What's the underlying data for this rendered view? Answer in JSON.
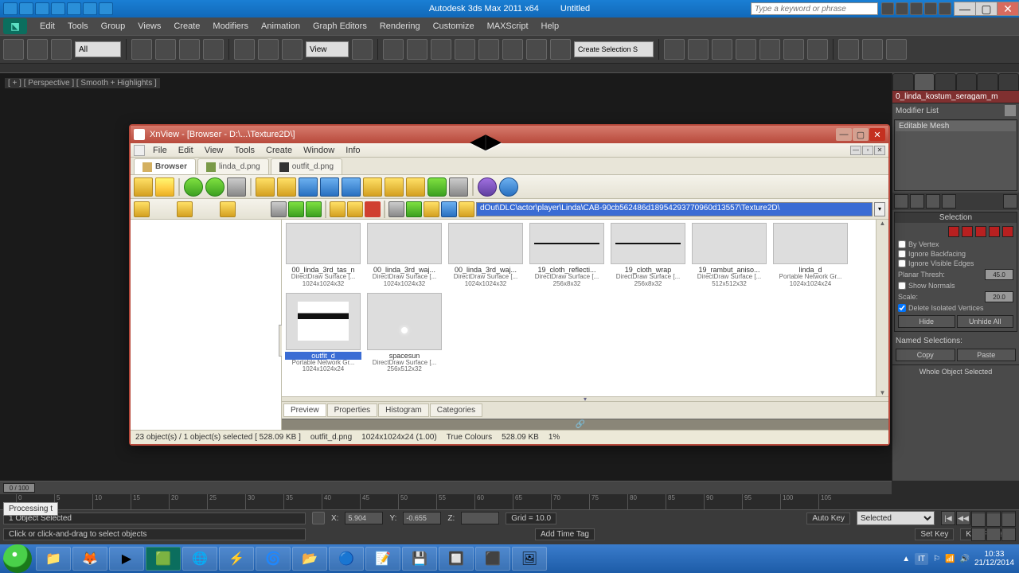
{
  "max": {
    "app": "Autodesk 3ds Max 2011 x64",
    "doc": "Untitled",
    "search_placeholder": "Type a keyword or phrase",
    "menu": [
      "Edit",
      "Tools",
      "Group",
      "Views",
      "Create",
      "Modifiers",
      "Animation",
      "Graph Editors",
      "Rendering",
      "Customize",
      "MAXScript",
      "Help"
    ],
    "selector_all": "All",
    "selector_view": "View",
    "selection_filter": "Create Selection S",
    "viewport_label": "[ + ] [ Perspective ] [ Smooth + Highlights ]",
    "command_panel": {
      "obj_name": "0_linda_kostum_seragam_m",
      "modifier_list": "Modifier List",
      "stack_item": "Editable Mesh",
      "rollout_selection": "Selection",
      "by_vertex": "By Vertex",
      "ignore_backfacing": "Ignore Backfacing",
      "ignore_visible": "Ignore Visible Edges",
      "planar_thresh": "Planar Thresh:",
      "planar_val": "45.0",
      "show_normals": "Show Normals",
      "scale_label": "Scale:",
      "scale_val": "20.0",
      "delete_isolated": "Delete Isolated Vertices",
      "hide": "Hide",
      "unhide_all": "Unhide All",
      "named_selections": "Named Selections:",
      "copy": "Copy",
      "paste": "Paste",
      "whole": "Whole Object Selected"
    },
    "timeline": {
      "thumb": "0 / 100",
      "ticks": [
        "0",
        "5",
        "10",
        "15",
        "20",
        "25",
        "30",
        "35",
        "40",
        "45",
        "50",
        "55",
        "60",
        "65",
        "70",
        "75",
        "80",
        "85",
        "90",
        "95",
        "100",
        "105"
      ]
    },
    "status": {
      "selected": "1 Object Selected",
      "hint": "Click or click-and-drag to select objects",
      "x": "X:",
      "xv": "5.904",
      "y": "Y:",
      "yv": "-0.655",
      "z": "Z:",
      "zv": "",
      "grid": "Grid = 10.0",
      "auto_key": "Auto Key",
      "set_key": "Set Key",
      "selected_combo": "Selected",
      "key_filters": "Key Filters...",
      "add_time_tag": "Add Time Tag",
      "processing": "Processing t"
    }
  },
  "xnview": {
    "title": "XnView - [Browser - D:\\...\\Texture2D\\]",
    "menu": [
      "File",
      "Edit",
      "View",
      "Tools",
      "Create",
      "Window",
      "Info"
    ],
    "tabs": [
      {
        "label": "Browser",
        "active": true
      },
      {
        "label": "linda_d.png",
        "active": false
      },
      {
        "label": "outfit_d.png",
        "active": false
      }
    ],
    "path": "dOut\\DLC\\actor\\player\\Linda\\CAB-90cb562486d18954293770960d13557\\Texture2D\\",
    "thumbs": [
      {
        "name": "00_linda_3rd_tas_n",
        "meta1": "DirectDraw Surface [...",
        "meta2": "1024x1024x32",
        "cls": "noise"
      },
      {
        "name": "00_linda_3rd_waj...",
        "meta1": "DirectDraw Surface [...",
        "meta2": "1024x1024x32",
        "cls": "white"
      },
      {
        "name": "00_linda_3rd_waj...",
        "meta1": "DirectDraw Surface [...",
        "meta2": "1024x1024x32",
        "cls": "gray"
      },
      {
        "name": "19_cloth_reflecti...",
        "meta1": "DirectDraw Surface [...",
        "meta2": "256x8x32",
        "cls": "line"
      },
      {
        "name": "19_cloth_wrap",
        "meta1": "DirectDraw Surface [...",
        "meta2": "256x8x32",
        "cls": "line"
      },
      {
        "name": "19_rambut_aniso...",
        "meta1": "DirectDraw Surface [...",
        "meta2": "512x512x32",
        "cls": "aniso"
      },
      {
        "name": "linda_d",
        "meta1": "Portable Network Gr...",
        "meta2": "1024x1024x24",
        "cls": "linda"
      },
      {
        "name": "outfit_d",
        "meta1": "Portable Network Gr...",
        "meta2": "1024x1024x24",
        "cls": "outfit",
        "selected": true,
        "tall": true
      },
      {
        "name": "spacesun",
        "meta1": "DirectDraw Surface [...",
        "meta2": "256x512x32",
        "cls": "spacesun",
        "tall": true
      }
    ],
    "bottom_tabs": [
      "Preview",
      "Properties",
      "Histogram",
      "Categories"
    ],
    "status": {
      "count": "23 object(s) / 1 object(s) selected  [ 528.09 KB ]",
      "file": "outfit_d.png",
      "dims": "1024x1024x24 (1.00)",
      "colours": "True Colours",
      "size": "528.09 KB",
      "zoom": "1%"
    }
  },
  "taskbar": {
    "lang": "IT",
    "time": "10:33",
    "date": "21/12/2014"
  }
}
